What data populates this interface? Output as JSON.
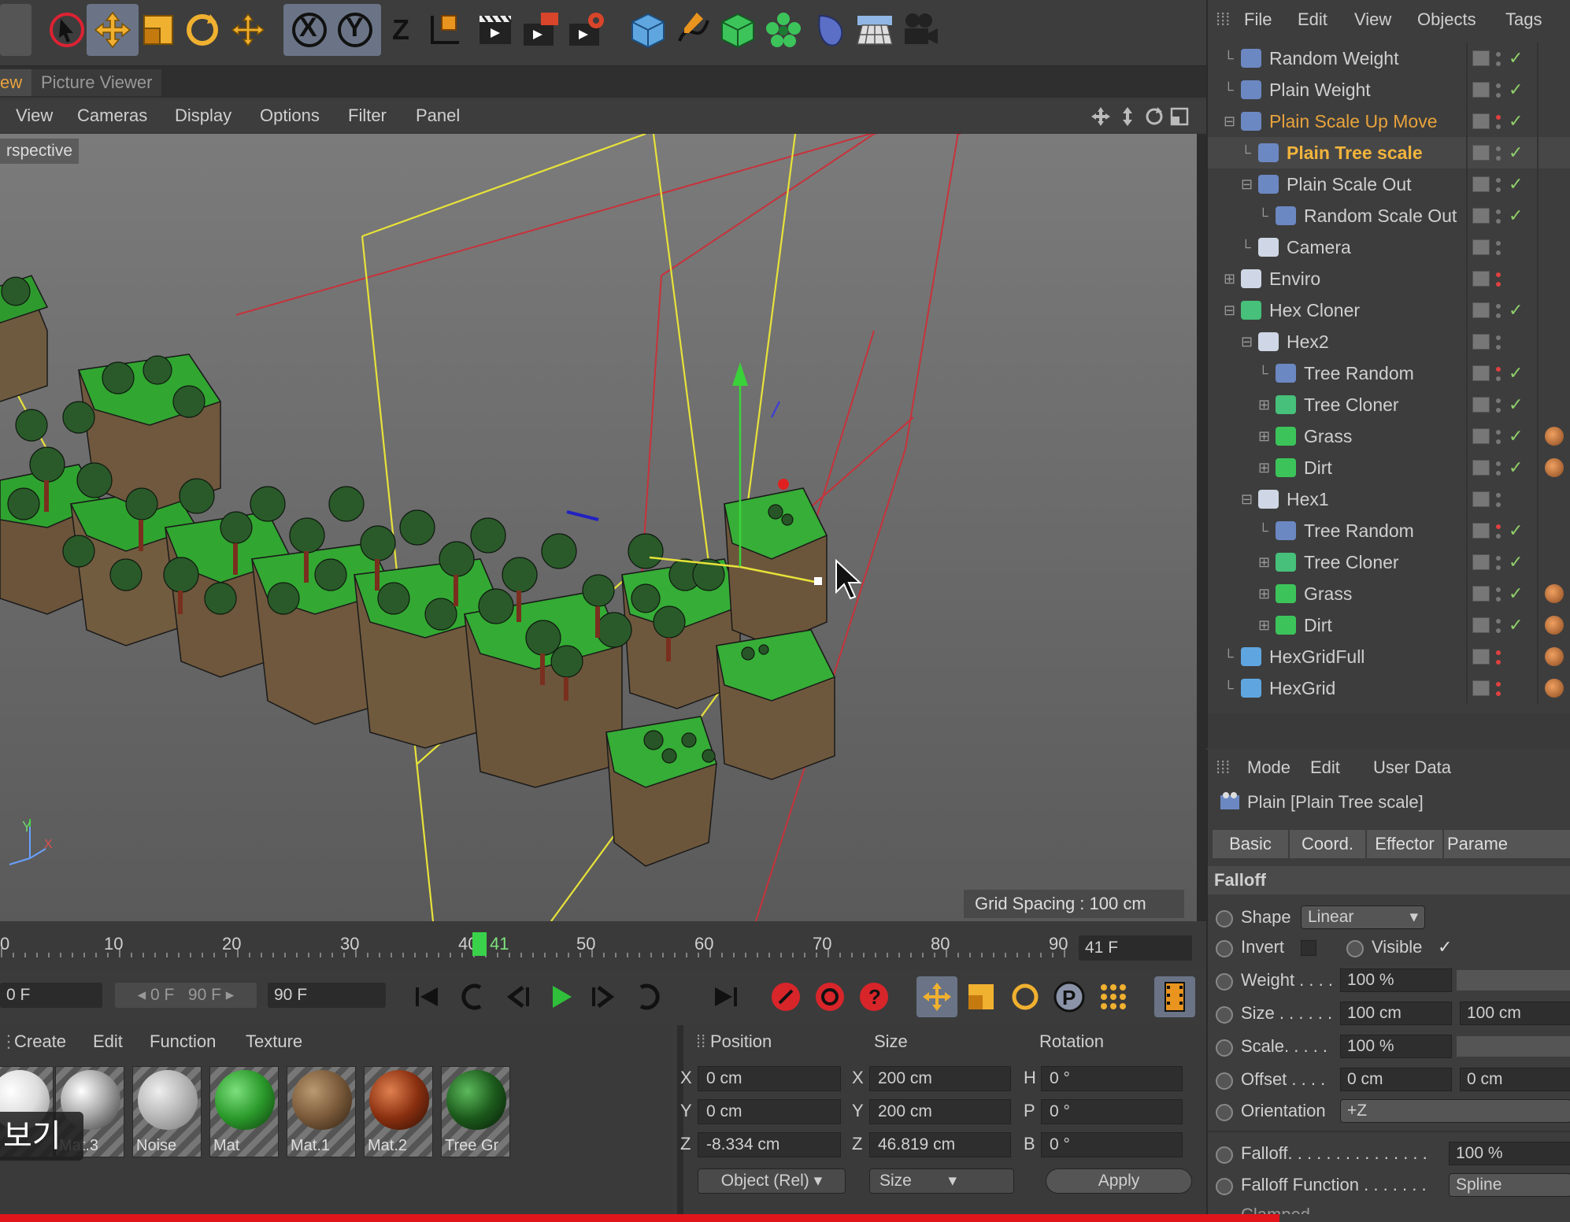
{
  "tabs": {
    "view_tab": "ew",
    "picture_viewer": "Picture Viewer"
  },
  "view_menu": [
    "View",
    "Cameras",
    "Display",
    "Options",
    "Filter",
    "Panel"
  ],
  "viewport": {
    "camera_label": "rspective",
    "grid_spacing": "Grid Spacing : 100 cm",
    "axis_y": "Y",
    "axis_x": "X"
  },
  "toolbar": {
    "x_label": "X",
    "y_label": "Y",
    "z_label": "Z"
  },
  "timeline": {
    "ticks": [
      "0",
      "10",
      "20",
      "30",
      "40",
      "41",
      "50",
      "60",
      "70",
      "80",
      "90"
    ],
    "current_frame": "41 F"
  },
  "transport": {
    "start": "0 F",
    "range_start": "0 F",
    "range_end": "90 F",
    "end": "90 F"
  },
  "materials": {
    "menu": [
      "Create",
      "Edit",
      "Function",
      "Texture"
    ],
    "items": [
      "",
      "Mat.3",
      "Noise",
      "Mat",
      "Mat.1",
      "Mat.2",
      "Tree Gr"
    ],
    "overlay_text": "보기"
  },
  "coords": {
    "headers": [
      "Position",
      "Size",
      "Rotation"
    ],
    "rows": [
      {
        "a": "X",
        "pos": "0 cm",
        "b": "X",
        "size": "200 cm",
        "c": "H",
        "rot": "0 °"
      },
      {
        "a": "Y",
        "pos": "0 cm",
        "b": "Y",
        "size": "200 cm",
        "c": "P",
        "rot": "0 °"
      },
      {
        "a": "Z",
        "pos": "-8.334 cm",
        "b": "Z",
        "size": "46.819 cm",
        "c": "B",
        "rot": "0 °"
      }
    ],
    "mode_select": "Object (Rel)",
    "size_select": "Size",
    "apply": "Apply"
  },
  "om": {
    "menu": [
      "File",
      "Edit",
      "View",
      "Objects",
      "Tags"
    ],
    "rows": [
      {
        "name": "Random Weight",
        "indent": 1,
        "color": "#cfcfcf"
      },
      {
        "name": "Plain Weight",
        "indent": 1,
        "color": "#cfcfcf"
      },
      {
        "name": "Plain Scale Up Move",
        "indent": 1,
        "color": "#e8a33c"
      },
      {
        "name": "Plain Tree scale",
        "indent": 2,
        "color": "#f2b43c"
      },
      {
        "name": "Plain Scale Out",
        "indent": 2,
        "color": "#cfcfcf"
      },
      {
        "name": "Random Scale Out",
        "indent": 3,
        "color": "#cfcfcf"
      },
      {
        "name": "Camera",
        "indent": 2,
        "color": "#cfcfcf"
      },
      {
        "name": "Enviro",
        "indent": 1,
        "color": "#cfcfcf"
      },
      {
        "name": "Hex Cloner",
        "indent": 1,
        "color": "#cfcfcf"
      },
      {
        "name": "Hex2",
        "indent": 2,
        "color": "#cfcfcf"
      },
      {
        "name": "Tree Random",
        "indent": 3,
        "color": "#cfcfcf"
      },
      {
        "name": "Tree Cloner",
        "indent": 3,
        "color": "#cfcfcf"
      },
      {
        "name": "Grass",
        "indent": 3,
        "color": "#cfcfcf"
      },
      {
        "name": "Dirt",
        "indent": 3,
        "color": "#cfcfcf"
      },
      {
        "name": "Hex1",
        "indent": 2,
        "color": "#cfcfcf"
      },
      {
        "name": "Tree Random",
        "indent": 3,
        "color": "#cfcfcf"
      },
      {
        "name": "Tree Cloner",
        "indent": 3,
        "color": "#cfcfcf"
      },
      {
        "name": "Grass",
        "indent": 3,
        "color": "#cfcfcf"
      },
      {
        "name": "Dirt",
        "indent": 3,
        "color": "#cfcfcf"
      },
      {
        "name": "HexGridFull",
        "indent": 1,
        "color": "#cfcfcf"
      },
      {
        "name": "HexGrid",
        "indent": 1,
        "color": "#cfcfcf"
      }
    ],
    "check": "✓"
  },
  "attr": {
    "menu": [
      "Mode",
      "Edit",
      "User Data"
    ],
    "title": "Plain [Plain Tree scale]",
    "tabs": [
      "Basic",
      "Coord.",
      "Effector",
      "Parame"
    ],
    "section": "Falloff",
    "shape_label": "Shape",
    "shape_value": "Linear",
    "invert_label": "Invert",
    "visible_label": "Visible",
    "weight_label": "Weight . . . .",
    "weight_value": "100 %",
    "size_label": "Size . . . . . .",
    "size_value1": "100 cm",
    "size_value2": "100 cm",
    "scale_label": "Scale. . . . .",
    "scale_value": "100 %",
    "offset_label": "Offset . . . .",
    "offset_value1": "0 cm",
    "offset_value2": "0 cm",
    "orient_label": "Orientation",
    "orient_value": "+Z",
    "falloff_label": "Falloff. . . . . . . . . . . . . . .",
    "falloff_value": "100 %",
    "falloff_fn_label": "Falloff Function . . . . . . .",
    "falloff_fn_value": "Spline",
    "clamped_label": "Clamped"
  },
  "colors": {
    "accent_orange": "#f2b43c",
    "video_progress": "#e0151b",
    "grass": "#2f9a2f",
    "dirt": "#7a5a3a"
  }
}
